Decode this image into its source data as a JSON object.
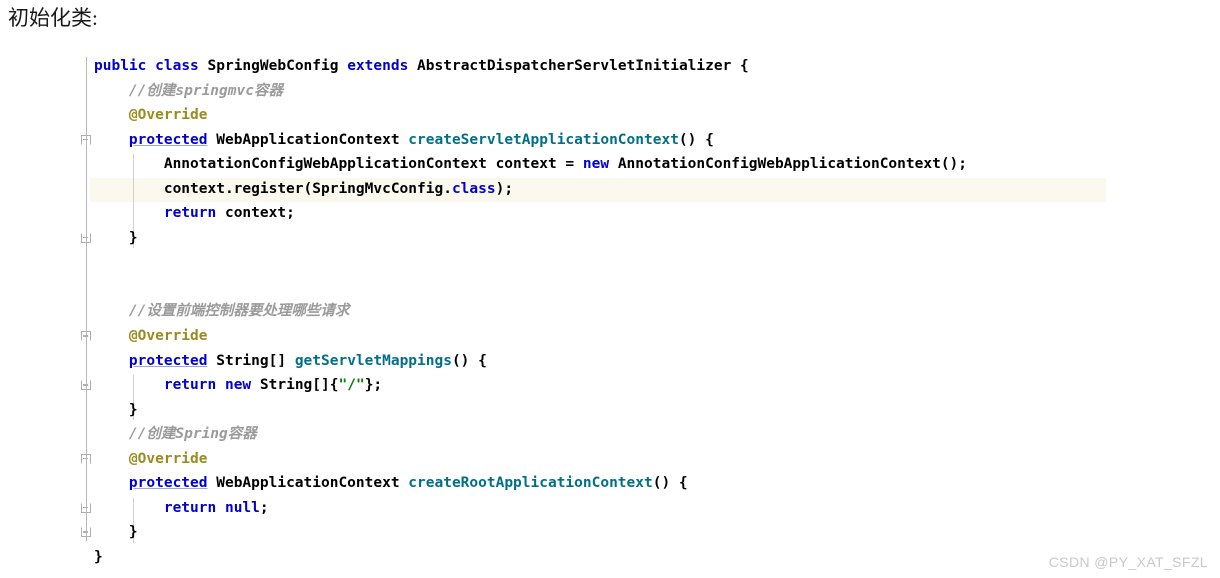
{
  "heading": "初始化类:",
  "watermark": "CSDN @PY_XAT_SFZL",
  "colors": {
    "background": "#ffffff",
    "keyword": "#0000d0",
    "method": "#007089",
    "annotation": "#9b8b1e",
    "string": "#008000",
    "comment": "#9b9b9b",
    "plain": "#000000",
    "caret_line_highlight": "#fbf9ee",
    "gutter_rule": "#b6b6b6",
    "indent_guide": "#d0d0d0",
    "watermark": "#c9c9c9"
  },
  "editor": {
    "language": "java",
    "caret_line_number": 6,
    "fold_markers": [
      {
        "type": "start",
        "line": 4
      },
      {
        "type": "end",
        "line": 8
      },
      {
        "type": "start",
        "line": 12
      },
      {
        "type": "end",
        "line": 14
      },
      {
        "type": "start",
        "line": 17
      },
      {
        "type": "end",
        "line": 19
      },
      {
        "type": "end",
        "line": 20
      }
    ]
  },
  "code": {
    "lines": [
      {
        "n": 1,
        "tokens": [
          {
            "t": "public",
            "c": "kw"
          },
          {
            "t": " ",
            "c": "pun"
          },
          {
            "t": "class",
            "c": "kw"
          },
          {
            "t": " ",
            "c": "pun"
          },
          {
            "t": "SpringWebConfig",
            "c": "type"
          },
          {
            "t": " ",
            "c": "pun"
          },
          {
            "t": "extends",
            "c": "kw"
          },
          {
            "t": " ",
            "c": "pun"
          },
          {
            "t": "AbstractDispatcherServletInitializer",
            "c": "type"
          },
          {
            "t": " {",
            "c": "pun"
          }
        ]
      },
      {
        "n": 2,
        "tokens": [
          {
            "t": "    ",
            "c": "pun"
          },
          {
            "t": "//创建springmvc容器",
            "c": "cmt"
          }
        ]
      },
      {
        "n": 3,
        "tokens": [
          {
            "t": "    ",
            "c": "pun"
          },
          {
            "t": "@Override",
            "c": "ann"
          }
        ]
      },
      {
        "n": 4,
        "tokens": [
          {
            "t": "    ",
            "c": "pun"
          },
          {
            "t": "protected",
            "c": "kw u"
          },
          {
            "t": " ",
            "c": "pun"
          },
          {
            "t": "WebApplicationContext",
            "c": "type"
          },
          {
            "t": " ",
            "c": "pun"
          },
          {
            "t": "createServletApplicationContext",
            "c": "mth"
          },
          {
            "t": "() {",
            "c": "pun"
          }
        ]
      },
      {
        "n": 5,
        "tokens": [
          {
            "t": "        ",
            "c": "pun"
          },
          {
            "t": "AnnotationConfigWebApplicationContext context = ",
            "c": "type"
          },
          {
            "t": "new",
            "c": "kw"
          },
          {
            "t": " ",
            "c": "pun"
          },
          {
            "t": "AnnotationConfigWebApplicationContext();",
            "c": "type"
          }
        ]
      },
      {
        "n": 6,
        "tokens": [
          {
            "t": "        ",
            "c": "pun"
          },
          {
            "t": "context.register(SpringMvcConfig.",
            "c": "type"
          },
          {
            "t": "class",
            "c": "kw"
          },
          {
            "t": ");",
            "c": "pun"
          }
        ]
      },
      {
        "n": 7,
        "tokens": [
          {
            "t": "        ",
            "c": "pun"
          },
          {
            "t": "return",
            "c": "kw"
          },
          {
            "t": " ",
            "c": "pun"
          },
          {
            "t": "context;",
            "c": "type"
          }
        ]
      },
      {
        "n": 8,
        "tokens": [
          {
            "t": "    }",
            "c": "pun"
          }
        ]
      },
      {
        "n": 9,
        "tokens": [
          {
            "t": "",
            "c": "pun"
          }
        ]
      },
      {
        "n": 10,
        "tokens": [
          {
            "t": "",
            "c": "pun"
          }
        ]
      },
      {
        "n": 11,
        "tokens": [
          {
            "t": "    ",
            "c": "pun"
          },
          {
            "t": "//设置前端控制器要处理哪些请求",
            "c": "cmt"
          }
        ]
      },
      {
        "n": 12,
        "tokens": [
          {
            "t": "    ",
            "c": "pun"
          },
          {
            "t": "@Override",
            "c": "ann"
          }
        ]
      },
      {
        "n": 13,
        "tokens": [
          {
            "t": "    ",
            "c": "pun"
          },
          {
            "t": "protected",
            "c": "kw u"
          },
          {
            "t": " ",
            "c": "pun"
          },
          {
            "t": "String[]",
            "c": "type"
          },
          {
            "t": " ",
            "c": "pun"
          },
          {
            "t": "getServletMappings",
            "c": "mth"
          },
          {
            "t": "() {",
            "c": "pun"
          }
        ]
      },
      {
        "n": 14,
        "tokens": [
          {
            "t": "        ",
            "c": "pun"
          },
          {
            "t": "return",
            "c": "kw"
          },
          {
            "t": " ",
            "c": "pun"
          },
          {
            "t": "new",
            "c": "kw"
          },
          {
            "t": " ",
            "c": "pun"
          },
          {
            "t": "String[]{",
            "c": "type"
          },
          {
            "t": "\"/\"",
            "c": "str"
          },
          {
            "t": "};",
            "c": "pun"
          }
        ]
      },
      {
        "n": 15,
        "tokens": [
          {
            "t": "    }",
            "c": "pun"
          }
        ]
      },
      {
        "n": 16,
        "tokens": [
          {
            "t": "    ",
            "c": "pun"
          },
          {
            "t": "//创建Spring容器",
            "c": "cmt"
          }
        ]
      },
      {
        "n": 17,
        "tokens": [
          {
            "t": "    ",
            "c": "pun"
          },
          {
            "t": "@Override",
            "c": "ann"
          }
        ]
      },
      {
        "n": 18,
        "tokens": [
          {
            "t": "    ",
            "c": "pun"
          },
          {
            "t": "protected",
            "c": "kw u"
          },
          {
            "t": " ",
            "c": "pun"
          },
          {
            "t": "WebApplicationContext",
            "c": "type"
          },
          {
            "t": " ",
            "c": "pun"
          },
          {
            "t": "createRootApplicationContext",
            "c": "mth"
          },
          {
            "t": "() {",
            "c": "pun"
          }
        ]
      },
      {
        "n": 19,
        "tokens": [
          {
            "t": "        ",
            "c": "pun"
          },
          {
            "t": "return",
            "c": "kw"
          },
          {
            "t": " ",
            "c": "pun"
          },
          {
            "t": "null",
            "c": "kw"
          },
          {
            "t": ";",
            "c": "pun"
          }
        ]
      },
      {
        "n": 20,
        "tokens": [
          {
            "t": "    }",
            "c": "pun"
          }
        ]
      },
      {
        "n": 21,
        "tokens": [
          {
            "t": "}",
            "c": "pun"
          }
        ]
      }
    ]
  }
}
